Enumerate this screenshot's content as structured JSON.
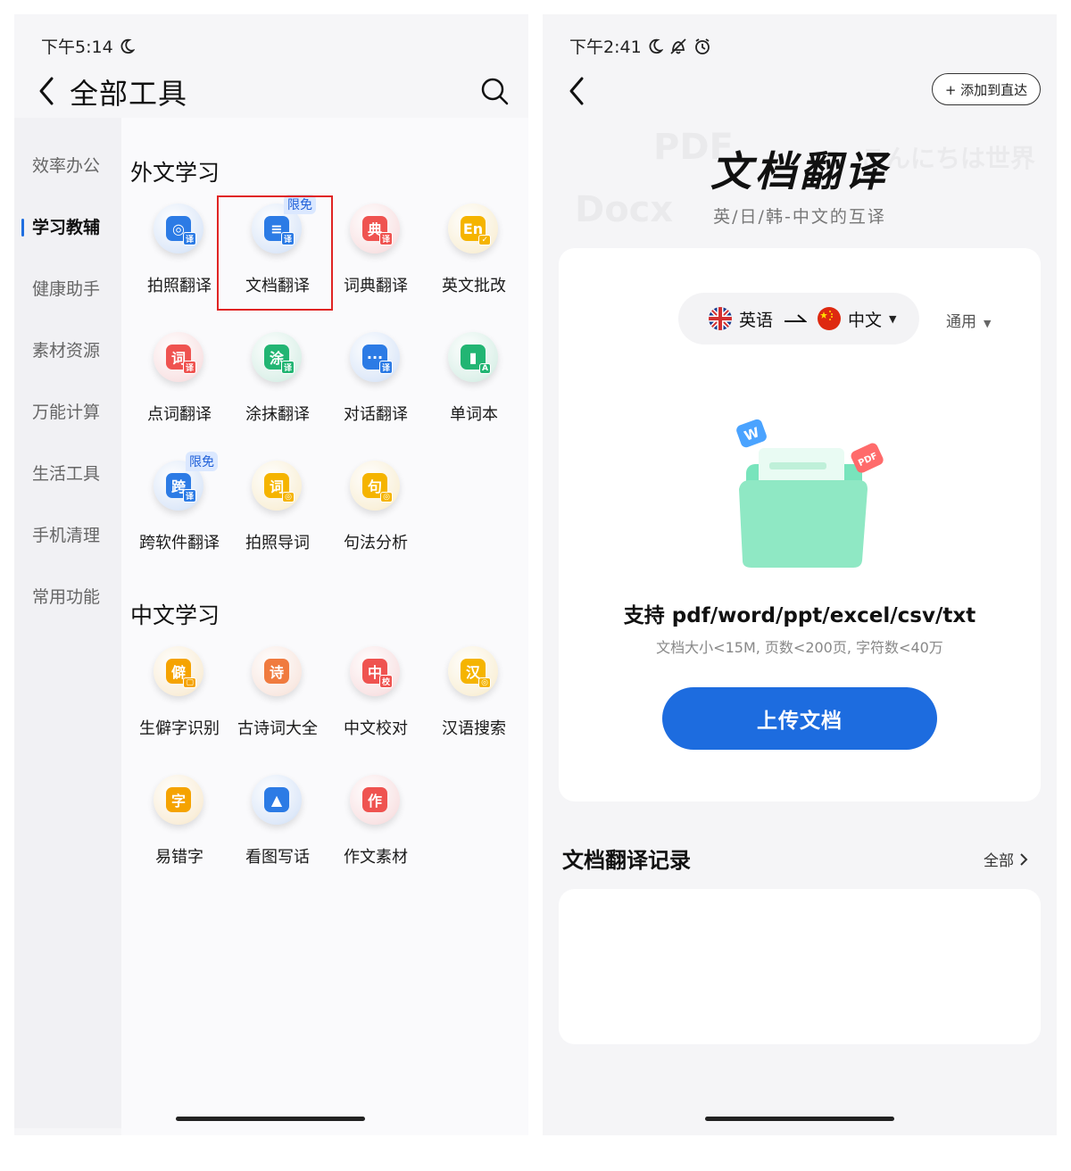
{
  "left": {
    "status_time": "下午5:14",
    "title": "全部工具",
    "sidebar": [
      {
        "label": "效率办公"
      },
      {
        "label": "学习教辅"
      },
      {
        "label": "健康助手"
      },
      {
        "label": "素材资源"
      },
      {
        "label": "万能计算"
      },
      {
        "label": "生活工具"
      },
      {
        "label": "手机清理"
      },
      {
        "label": "常用功能"
      }
    ],
    "active_sidebar": "学习教辅",
    "sections": [
      {
        "title": "外文学习",
        "tools": [
          {
            "label": "拍照翻译",
            "glyph": "◎",
            "sub": "译",
            "color": "#2c7be5"
          },
          {
            "label": "文档翻译",
            "glyph": "≡",
            "sub": "译",
            "color": "#2c7be5",
            "badge": "限免"
          },
          {
            "label": "词典翻译",
            "glyph": "典",
            "sub": "译",
            "color": "#ef5350"
          },
          {
            "label": "英文批改",
            "glyph": "En",
            "sub": "✓",
            "color": "#f5b400"
          },
          {
            "label": "点词翻译",
            "glyph": "词",
            "sub": "译",
            "color": "#ef5350"
          },
          {
            "label": "涂抹翻译",
            "glyph": "涂",
            "sub": "译",
            "color": "#22b573"
          },
          {
            "label": "对话翻译",
            "glyph": "···",
            "sub": "译",
            "color": "#2c7be5"
          },
          {
            "label": "单词本",
            "glyph": "▮",
            "sub": "A",
            "color": "#22b573"
          },
          {
            "label": "跨软件翻译",
            "glyph": "跨",
            "sub": "译",
            "color": "#2c7be5",
            "badge": "限免"
          },
          {
            "label": "拍照导词",
            "glyph": "词",
            "sub": "◎",
            "color": "#f5b400"
          },
          {
            "label": "句法分析",
            "glyph": "句",
            "sub": "◎",
            "color": "#f5b400"
          }
        ]
      },
      {
        "title": "中文学习",
        "tools": [
          {
            "label": "生僻字识别",
            "glyph": "僻",
            "sub": "▢",
            "color": "#f5a300"
          },
          {
            "label": "古诗词大全",
            "glyph": "诗",
            "sub": "",
            "color": "#f07b3f"
          },
          {
            "label": "中文校对",
            "glyph": "中",
            "sub": "校",
            "color": "#ef5350"
          },
          {
            "label": "汉语搜索",
            "glyph": "汉",
            "sub": "◎",
            "color": "#f5b400"
          },
          {
            "label": "易错字",
            "glyph": "字",
            "sub": "",
            "color": "#f5a300"
          },
          {
            "label": "看图写话",
            "glyph": "▲",
            "sub": "",
            "color": "#2c7be5"
          },
          {
            "label": "作文素材",
            "glyph": "作",
            "sub": "",
            "color": "#ef5350"
          }
        ]
      }
    ]
  },
  "right": {
    "status_time": "下午2:41",
    "pin_button": "+ 添加到直达",
    "hero_title": "文档翻译",
    "hero_subtitle": "英/日/韩-中文的互译",
    "ghost_words": [
      "PDF",
      "Docx",
      "こんにちは世界"
    ],
    "source_lang": "英语",
    "target_lang": "中文",
    "mode": "通用",
    "file_tags": [
      "W",
      "PDF"
    ],
    "support_text": "支持 pdf/word/ppt/excel/csv/txt",
    "limit_text": "文档大小<15M, 页数<200页, 字符数<40万",
    "upload_button": "上传文档",
    "records_title": "文档翻译记录",
    "records_all": "全部"
  },
  "colors": {
    "accent": "#1d6cdf",
    "highlight": "#e02424"
  }
}
